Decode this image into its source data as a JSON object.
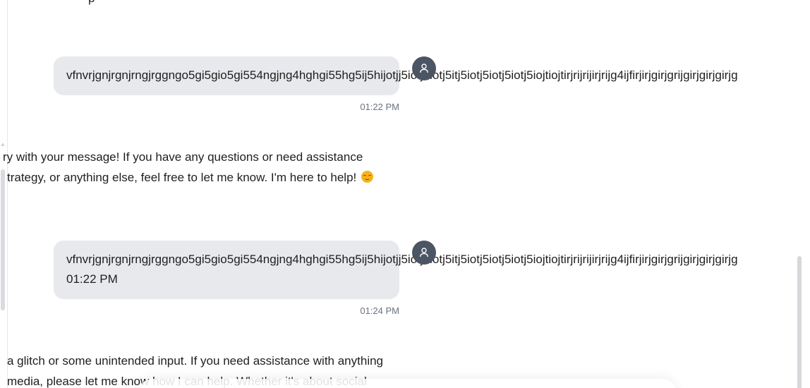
{
  "conversation": {
    "top_fragment": "p",
    "messages": [
      {
        "role": "user",
        "lines": [
          "vfnvrjgnjrgnjrngjrggngo5gi5gio5gi554ngjng4hghgi55hg5ij5hijotjj5iotj5iotj5itj5iotj5iotj5iotj5iojtiojtirjrijrijirjrijg4ijfirjirjgirjgrijgirjgirjgirjg"
        ],
        "time": "01:22 PM"
      },
      {
        "role": "assistant",
        "lines": [
          "ry with your message! If you have any questions or need assistance",
          "trategy, or anything else, feel free to let me know. I'm here to help!"
        ],
        "emoji": "smiling-face-emoji"
      },
      {
        "role": "user",
        "lines": [
          "vfnvrjgnjrgnjrngjrggngo5gi5gio5gi554ngjng4hghgi55hg5ij5hijotjj5iotj5iotj5itj5iotj5iotj5iotj5iojtiojtirjrijrijirjrijg4ijfirjirjgirjgrijgirjgirjgirjg",
          "01:22 PM"
        ],
        "time": "01:24 PM"
      },
      {
        "role": "assistant",
        "lines": [
          "a glitch or some unintended input. If you need assistance with anything",
          "media, please let me know how I can help. Whether it's about social"
        ]
      }
    ]
  },
  "icons": {
    "avatar": "user-icon"
  }
}
